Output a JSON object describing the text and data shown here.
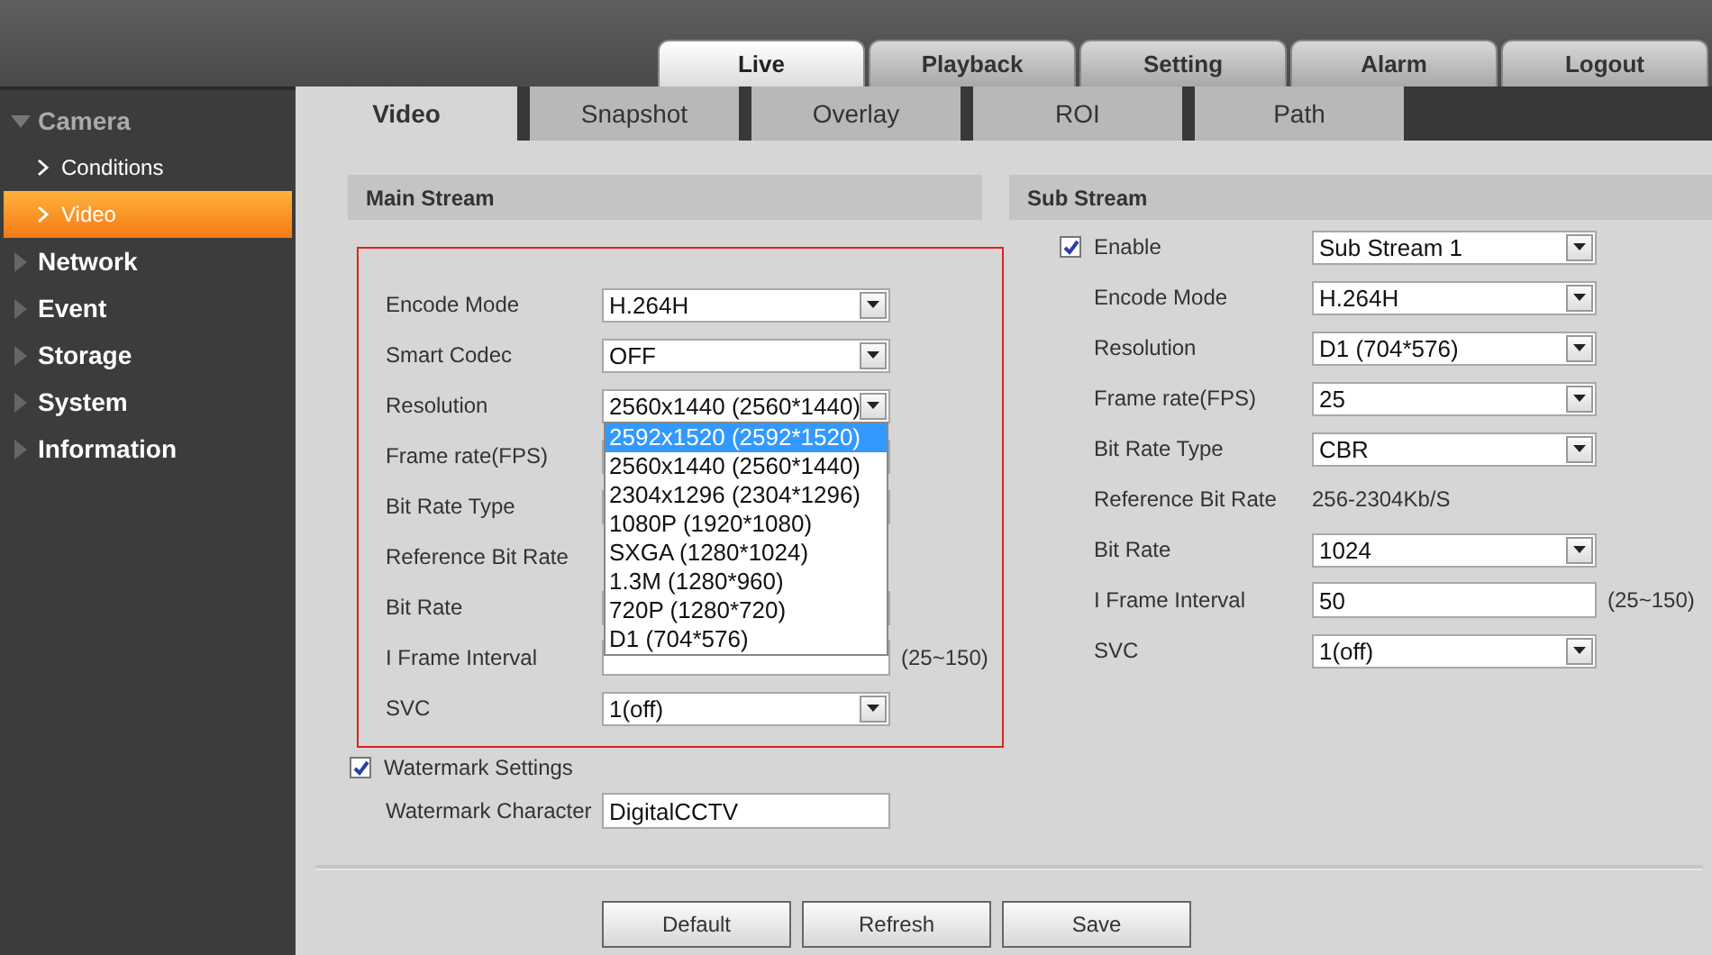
{
  "top_tabs": [
    {
      "label": "Live",
      "selected": true
    },
    {
      "label": "Playback",
      "selected": false
    },
    {
      "label": "Setting",
      "selected": false
    },
    {
      "label": "Alarm",
      "selected": false
    },
    {
      "label": "Logout",
      "selected": false
    }
  ],
  "sidebar": {
    "items": [
      {
        "label": "Camera",
        "expanded": true,
        "selected": false,
        "children": [
          {
            "label": "Conditions",
            "selected": false
          },
          {
            "label": "Video",
            "selected": true
          }
        ]
      },
      {
        "label": "Network",
        "expanded": false,
        "selected": false
      },
      {
        "label": "Event",
        "expanded": false,
        "selected": false
      },
      {
        "label": "Storage",
        "expanded": false,
        "selected": false
      },
      {
        "label": "System",
        "expanded": false,
        "selected": false
      },
      {
        "label": "Information",
        "expanded": false,
        "selected": false
      }
    ]
  },
  "sub_tabs": [
    {
      "label": "Video",
      "selected": true
    },
    {
      "label": "Snapshot",
      "selected": false
    },
    {
      "label": "Overlay",
      "selected": false
    },
    {
      "label": "ROI",
      "selected": false
    },
    {
      "label": "Path",
      "selected": false
    }
  ],
  "main_stream": {
    "title": "Main Stream",
    "rows": [
      {
        "label": "Encode Mode",
        "kind": "select",
        "value": "H.264H"
      },
      {
        "label": "Smart Codec",
        "kind": "select",
        "value": "OFF"
      },
      {
        "label": "Resolution",
        "kind": "select",
        "value": "2560x1440 (2560*1440)",
        "open": true,
        "options": [
          {
            "label": "2592x1520 (2592*1520)",
            "highlighted": true
          },
          {
            "label": "2560x1440 (2560*1440)",
            "highlighted": false
          },
          {
            "label": "2304x1296 (2304*1296)",
            "highlighted": false
          },
          {
            "label": "1080P (1920*1080)",
            "highlighted": false
          },
          {
            "label": "SXGA (1280*1024)",
            "highlighted": false
          },
          {
            "label": "1.3M (1280*960)",
            "highlighted": false
          },
          {
            "label": "720P (1280*720)",
            "highlighted": false
          },
          {
            "label": "D1 (704*576)",
            "highlighted": false
          }
        ]
      },
      {
        "label": "Frame rate(FPS)",
        "kind": "select"
      },
      {
        "label": "Bit Rate Type",
        "kind": "select"
      },
      {
        "label": "Reference Bit Rate",
        "kind": "text"
      },
      {
        "label": "Bit Rate",
        "kind": "select"
      },
      {
        "label": "I Frame Interval",
        "kind": "input",
        "suffix": "(25~150)"
      },
      {
        "label": "SVC",
        "kind": "select",
        "value": "1(off)"
      }
    ],
    "watermark": {
      "label": "Watermark Settings",
      "checked": true
    },
    "watermark_character": {
      "label": "Watermark Character",
      "value": "DigitalCCTV"
    }
  },
  "sub_stream": {
    "title": "Sub Stream",
    "enable": {
      "label": "Enable",
      "checked": true,
      "value": "Sub Stream 1"
    },
    "rows": [
      {
        "label": "Encode Mode",
        "kind": "select",
        "value": "H.264H"
      },
      {
        "label": "Resolution",
        "kind": "select",
        "value": "D1 (704*576)"
      },
      {
        "label": "Frame rate(FPS)",
        "kind": "select",
        "value": "25"
      },
      {
        "label": "Bit Rate Type",
        "kind": "select",
        "value": "CBR"
      },
      {
        "label": "Reference Bit Rate",
        "kind": "text",
        "value": "256-2304Kb/S"
      },
      {
        "label": "Bit Rate",
        "kind": "select",
        "value": "1024"
      },
      {
        "label": "I Frame Interval",
        "kind": "input",
        "value": "50",
        "suffix": "(25~150)"
      },
      {
        "label": "SVC",
        "kind": "select",
        "value": "1(off)"
      }
    ]
  },
  "buttons": [
    "Default",
    "Refresh",
    "Save"
  ]
}
